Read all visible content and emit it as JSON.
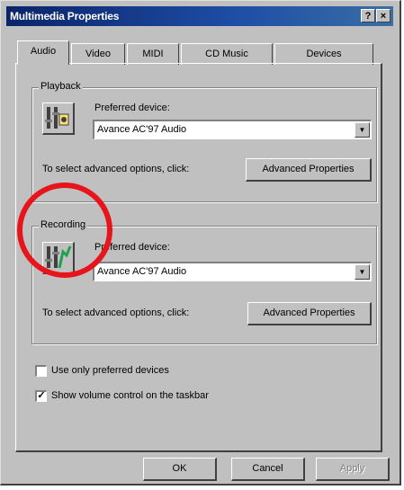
{
  "window": {
    "title": "Multimedia Properties",
    "help_glyph": "?",
    "close_glyph": "×"
  },
  "tabs": [
    {
      "label": "Audio",
      "active": true
    },
    {
      "label": "Video",
      "active": false
    },
    {
      "label": "MIDI",
      "active": false
    },
    {
      "label": "CD Music",
      "active": false
    },
    {
      "label": "Devices",
      "active": false
    }
  ],
  "playback": {
    "group_label": "Playback",
    "icon": "speaker-icon",
    "preferred_device_label": "Preferred device:",
    "device_value": "Avance AC'97 Audio",
    "hint": "To select advanced options, click:",
    "advanced_button": "Advanced Properties"
  },
  "recording": {
    "group_label": "Recording",
    "icon": "microphone-icon",
    "preferred_device_label": "Preferred device:",
    "device_value": "Avance AC'97 Audio",
    "hint": "To select advanced options, click:",
    "advanced_button": "Advanced Properties"
  },
  "options": {
    "use_only_preferred": {
      "label": "Use only preferred devices",
      "checked": false
    },
    "show_volume_control": {
      "label": "Show volume control on the taskbar",
      "checked": true
    }
  },
  "footer": {
    "ok": "OK",
    "cancel": "Cancel",
    "apply": "Apply"
  },
  "colors": {
    "annotation": "#e8141c",
    "titlebar": "#0a246a",
    "face": "#c0c0c0"
  }
}
